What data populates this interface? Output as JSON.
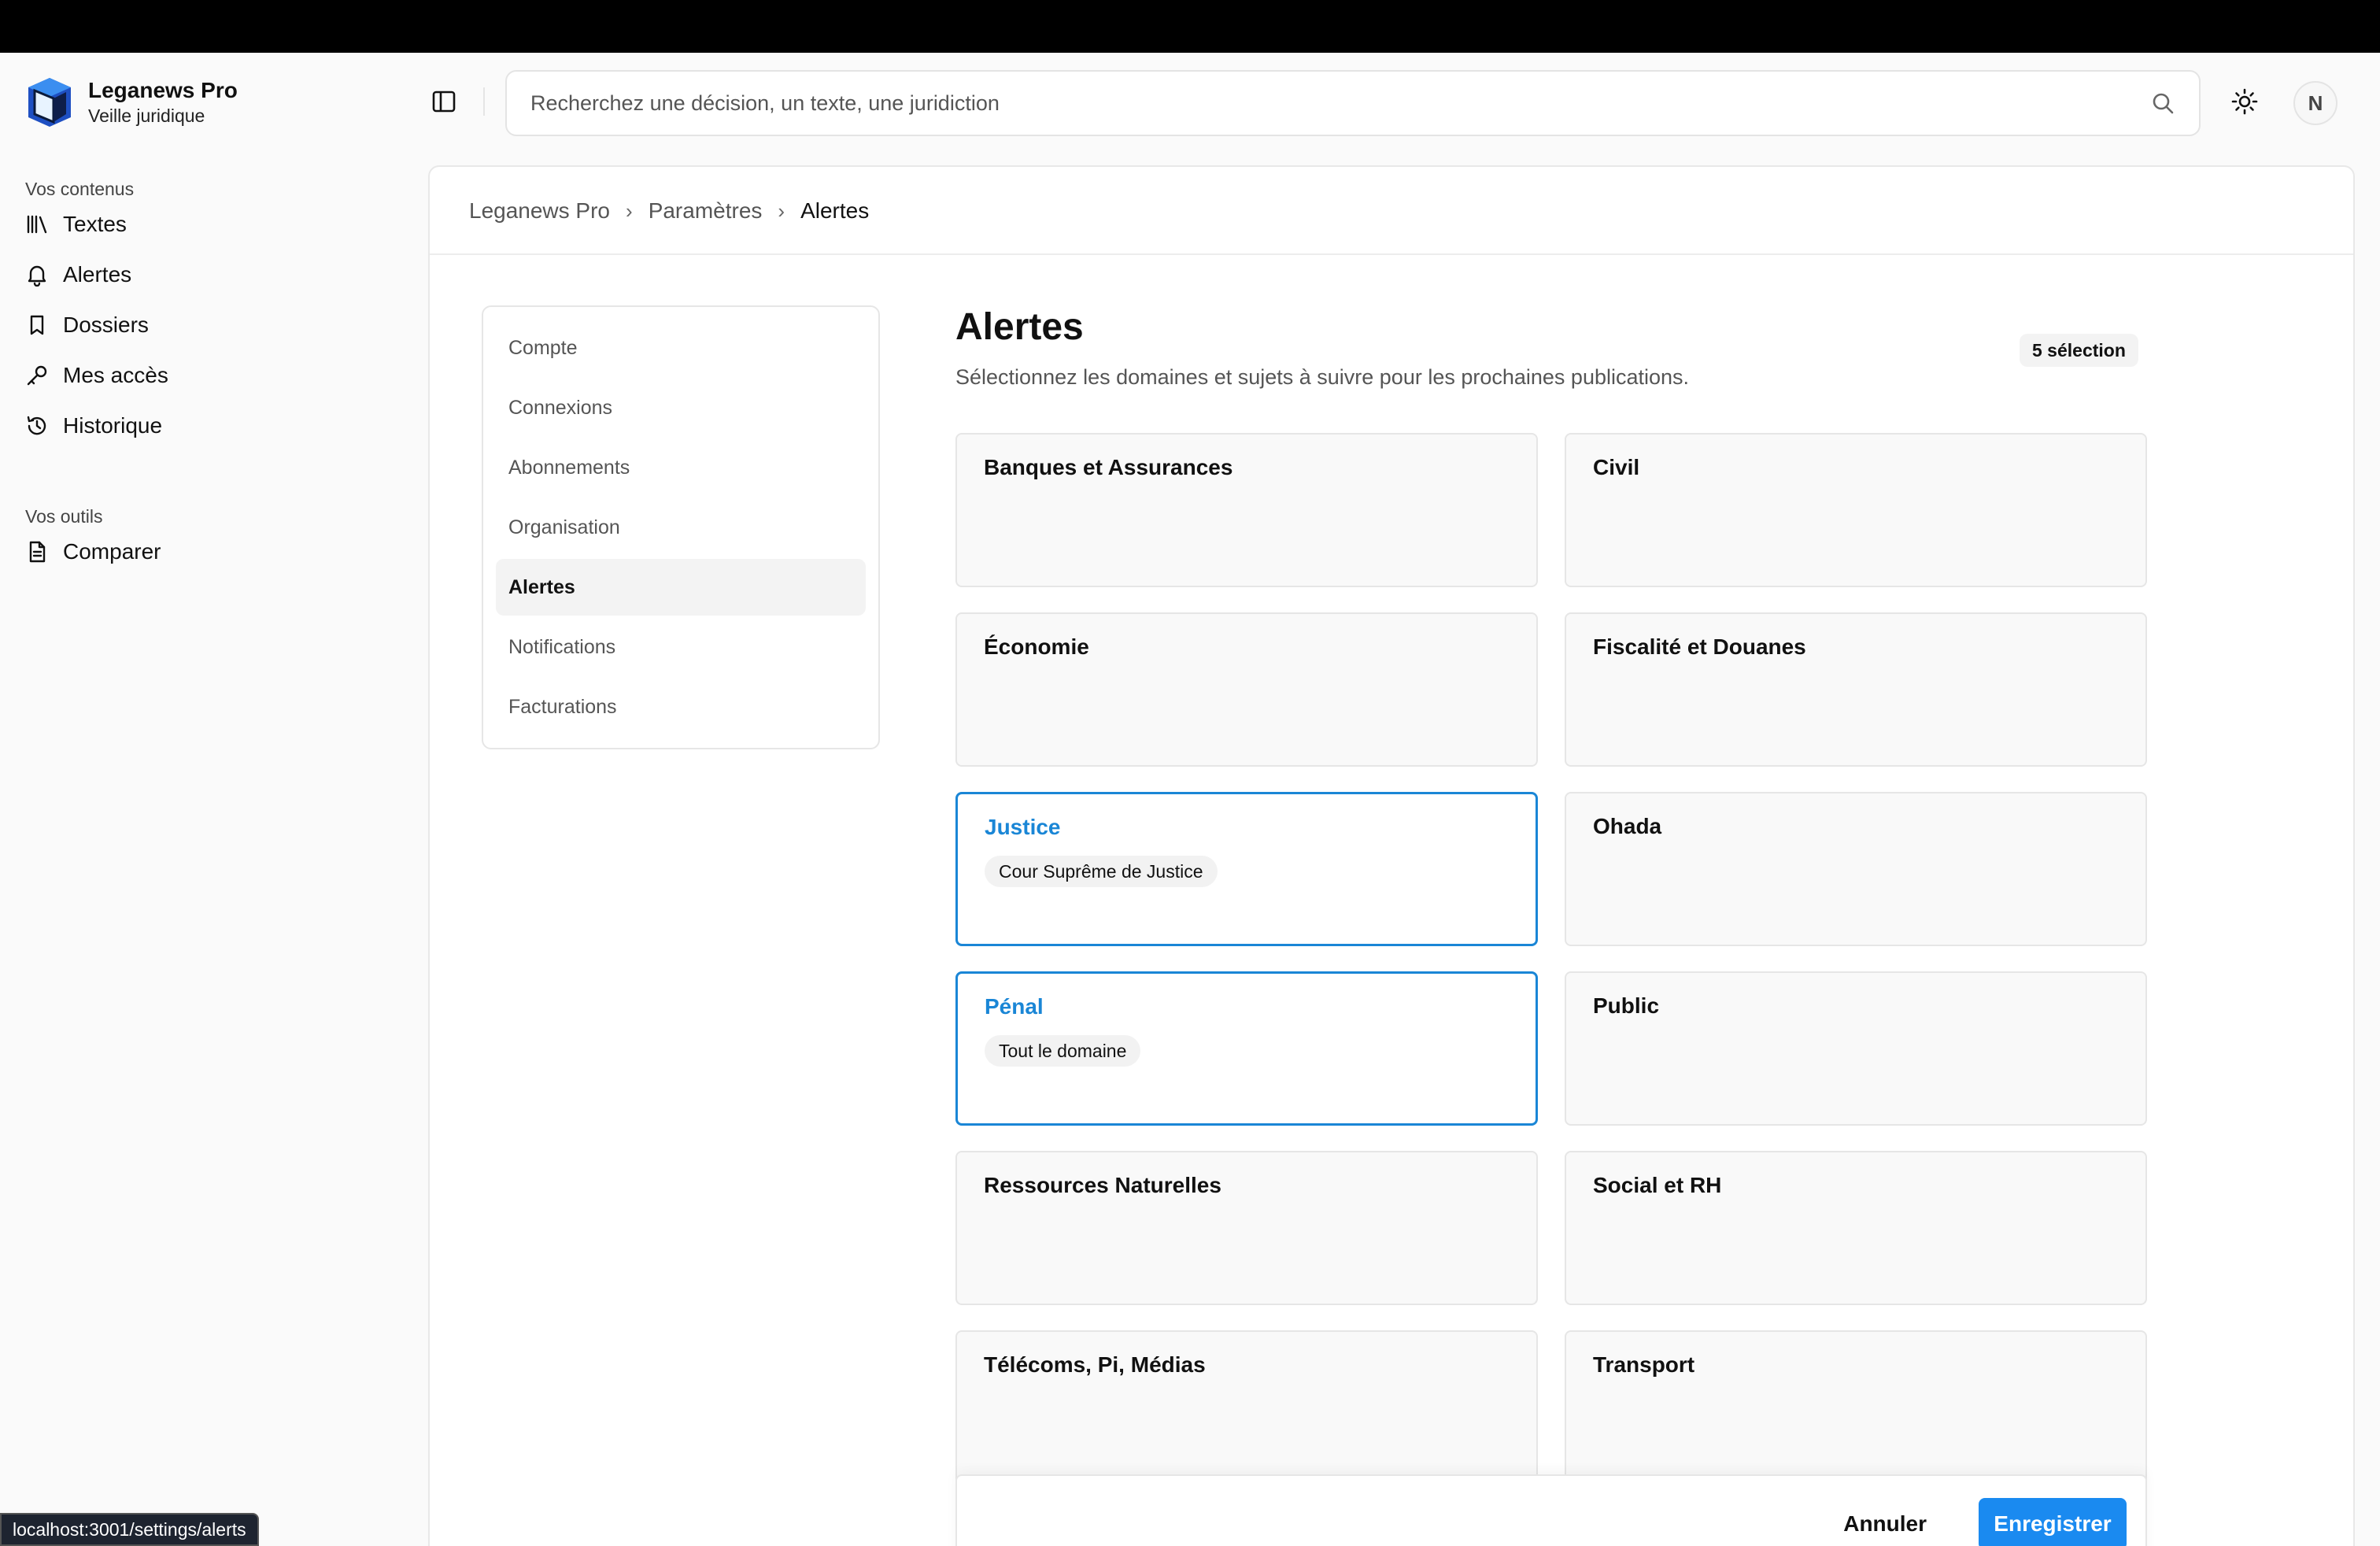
{
  "brand": {
    "name": "Leganews Pro",
    "subtitle": "Veille juridique"
  },
  "sidebar": {
    "section_contents": "Vos contenus",
    "section_tools": "Vos outils",
    "items": [
      {
        "label": "Textes",
        "icon": "library-icon"
      },
      {
        "label": "Alertes",
        "icon": "bell-icon"
      },
      {
        "label": "Dossiers",
        "icon": "bookmark-icon"
      },
      {
        "label": "Mes accès",
        "icon": "key-icon"
      },
      {
        "label": "Historique",
        "icon": "history-icon"
      }
    ],
    "tools": [
      {
        "label": "Comparer",
        "icon": "file-text-icon"
      }
    ]
  },
  "header": {
    "search_placeholder": "Recherchez une décision, un texte, une juridiction",
    "avatar_initial": "N"
  },
  "breadcrumb": [
    "Leganews Pro",
    "Paramètres",
    "Alertes"
  ],
  "settings_nav": {
    "items": [
      "Compte",
      "Connexions",
      "Abonnements",
      "Organisation",
      "Alertes",
      "Notifications",
      "Facturations"
    ],
    "active": "Alertes"
  },
  "content": {
    "title": "Alertes",
    "subtitle": "Sélectionnez les domaines et sujets à suivre pour les prochaines publications.",
    "selection_badge": "5 sélection"
  },
  "domains": [
    {
      "title": "Banques et Assurances",
      "selected": false,
      "chip": ""
    },
    {
      "title": "Civil",
      "selected": false,
      "chip": ""
    },
    {
      "title": "Économie",
      "selected": false,
      "chip": ""
    },
    {
      "title": "Fiscalité et Douanes",
      "selected": false,
      "chip": ""
    },
    {
      "title": "Justice",
      "selected": true,
      "chip": "Cour Suprême de Justice"
    },
    {
      "title": "Ohada",
      "selected": false,
      "chip": ""
    },
    {
      "title": "Pénal",
      "selected": true,
      "chip": "Tout le domaine"
    },
    {
      "title": "Public",
      "selected": false,
      "chip": ""
    },
    {
      "title": "Ressources Naturelles",
      "selected": false,
      "chip": ""
    },
    {
      "title": "Social et RH",
      "selected": false,
      "chip": ""
    },
    {
      "title": "Télécoms, Pi, Médias",
      "selected": false,
      "chip": ""
    },
    {
      "title": "Transport",
      "selected": false,
      "chip": ""
    }
  ],
  "actions": {
    "cancel": "Annuler",
    "save": "Enregistrer"
  },
  "status_url": "localhost:3001/settings/alerts",
  "colors": {
    "accent": "#1a86d6",
    "save_button": "#1a8af0"
  }
}
